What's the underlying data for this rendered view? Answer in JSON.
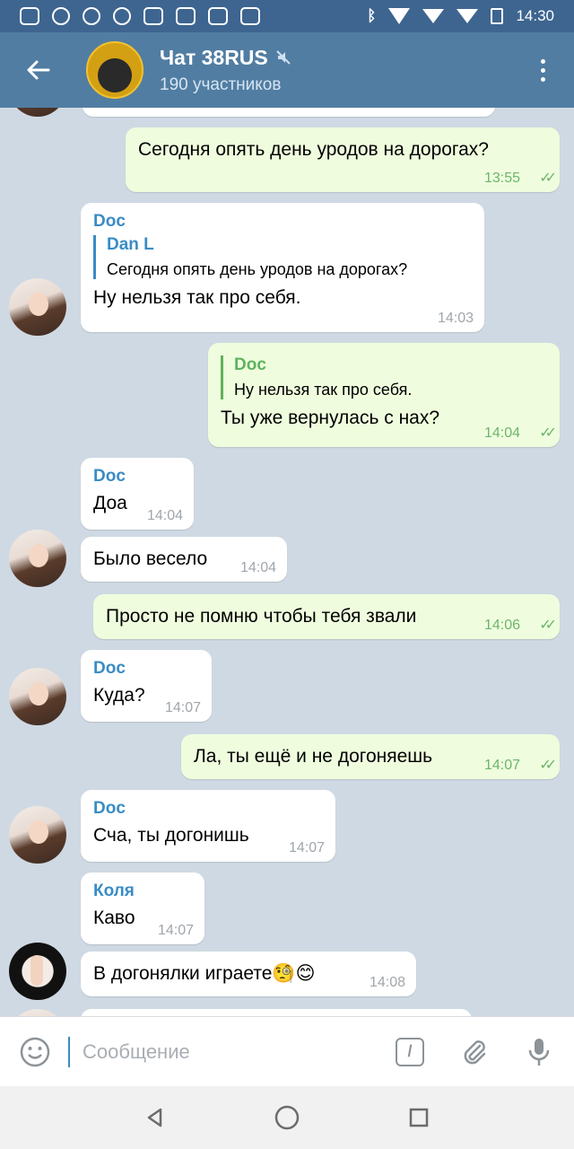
{
  "status_bar": {
    "time": "14:30"
  },
  "header": {
    "title": "Чат 38RUS",
    "subtitle": "190 участников",
    "muted_icon": "muted-icon"
  },
  "messages": [
    {
      "text": "Сегодня опять день уродов на дорогах?",
      "time": "13:55",
      "dir": "out"
    },
    {
      "sender": "Doc",
      "reply_name": "Dan L",
      "reply_text": "Сегодня опять день уродов на дорогах?",
      "text": "Ну нельзя так про себя.",
      "time": "14:03",
      "dir": "in"
    },
    {
      "reply_name": "Doc",
      "reply_text": "Ну нельзя так про себя.",
      "text": "Ты уже вернулась с нах?",
      "time": "14:04",
      "dir": "out"
    },
    {
      "sender": "Doc",
      "text": "Доа",
      "time": "14:04",
      "dir": "in"
    },
    {
      "text": "Было весело",
      "time": "14:04",
      "dir": "in"
    },
    {
      "text": "Просто не помню чтобы тебя звали",
      "time": "14:06",
      "dir": "out"
    },
    {
      "sender": "Doc",
      "text": "Куда?",
      "time": "14:07",
      "dir": "in"
    },
    {
      "text": "Ла, ты ещё и не догоняешь",
      "time": "14:07",
      "dir": "out"
    },
    {
      "sender": "Doc",
      "text": "Сча, ты догонишь",
      "time": "14:07",
      "dir": "in"
    },
    {
      "sender": "Коля",
      "text": "Каво",
      "time": "14:07",
      "dir": "in"
    },
    {
      "text": "В догонялки играете🧐😊",
      "time": "14:08",
      "dir": "in"
    }
  ],
  "input": {
    "placeholder": "Сообщение",
    "command_label": "/"
  }
}
